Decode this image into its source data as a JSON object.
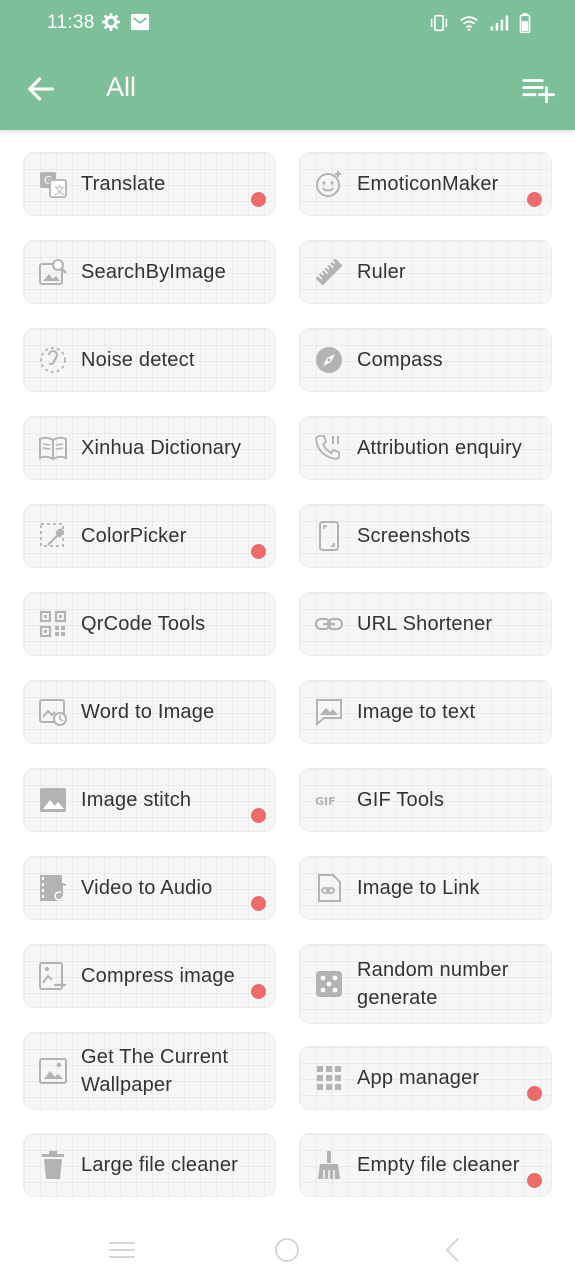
{
  "status_bar": {
    "time": "11:38",
    "icons_left": [
      "gear-icon",
      "mail-icon"
    ],
    "icons_right": [
      "vibrate-icon",
      "wifi-icon",
      "signal-icon",
      "battery-icon"
    ]
  },
  "app_bar": {
    "title": "All",
    "back_icon": "arrow-left-icon",
    "action_icon": "playlist-add-icon"
  },
  "colors": {
    "primary": "#7dbf99",
    "card_bg": "#f6f6f6",
    "badge": "#ec6b6b",
    "text": "#333333",
    "icon": "#b3b3b3"
  },
  "tools": [
    {
      "label": "Translate",
      "icon": "translate-icon",
      "badge": true
    },
    {
      "label": "EmoticonMaker",
      "icon": "emoticon-icon",
      "badge": true
    },
    {
      "label": "SearchByImage",
      "icon": "image-search-icon",
      "badge": false
    },
    {
      "label": "Ruler",
      "icon": "ruler-icon",
      "badge": false
    },
    {
      "label": "Noise detect",
      "icon": "noise-icon",
      "badge": false
    },
    {
      "label": "Compass",
      "icon": "compass-icon",
      "badge": false
    },
    {
      "label": "Xinhua Dictionary",
      "icon": "book-icon",
      "badge": false
    },
    {
      "label": "Attribution enquiry",
      "icon": "phone-pause-icon",
      "badge": false
    },
    {
      "label": "ColorPicker",
      "icon": "color-picker-icon",
      "badge": true
    },
    {
      "label": "Screenshots",
      "icon": "phone-screenshot-icon",
      "badge": false
    },
    {
      "label": "QrCode Tools",
      "icon": "qrcode-icon",
      "badge": false
    },
    {
      "label": "URL Shortener",
      "icon": "link-icon",
      "badge": false
    },
    {
      "label": "Word to Image",
      "icon": "image-refresh-icon",
      "badge": false
    },
    {
      "label": "Image to text",
      "icon": "image-message-icon",
      "badge": false
    },
    {
      "label": "Image stitch",
      "icon": "image-icon",
      "badge": true
    },
    {
      "label": "GIF Tools",
      "icon": "gif-icon",
      "badge": false
    },
    {
      "label": "Video to Audio",
      "icon": "video-music-icon",
      "badge": true
    },
    {
      "label": "Image to Link",
      "icon": "file-link-icon",
      "badge": false
    },
    {
      "label": "Compress image",
      "icon": "image-compress-icon",
      "badge": true
    },
    {
      "label": "Random number generate",
      "icon": "dice-icon",
      "badge": false
    },
    {
      "label": "Get The Current Wallpaper",
      "icon": "wallpaper-icon",
      "badge": false
    },
    {
      "label": "App manager",
      "icon": "apps-grid-icon",
      "badge": true
    },
    {
      "label": "Large file cleaner",
      "icon": "trash-icon",
      "badge": false
    },
    {
      "label": "Empty file cleaner",
      "icon": "broom-icon",
      "badge": true
    }
  ],
  "nav_bar": {
    "items": [
      "menu-icon",
      "home-circle-icon",
      "back-triangle-icon"
    ]
  }
}
